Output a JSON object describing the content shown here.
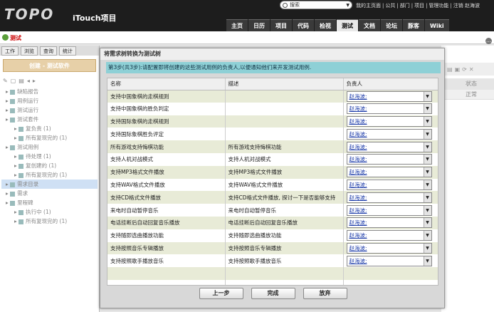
{
  "header": {
    "logo": "TOPO",
    "app_name": "iTouch项目",
    "search_placeholder": "搜索",
    "top_links": [
      "我的主页面",
      "公共",
      "部门",
      "项目",
      "管理功能",
      "注销 赵海波"
    ],
    "nav_tabs": [
      "主页",
      "日历",
      "项目",
      "代码",
      "检视",
      "测试",
      "文档",
      "论坛",
      "豚客",
      "Wiki"
    ],
    "active_tab": "测试"
  },
  "subbar": {
    "title": "测试"
  },
  "left": {
    "tabs": [
      "工作",
      "浏览",
      "查询",
      "统计"
    ],
    "create_button": "创建 - 测试软件",
    "tree": [
      {
        "label": "缺陷报告",
        "level": 0
      },
      {
        "label": "用例运行",
        "level": 0
      },
      {
        "label": "测试运行",
        "level": 0
      },
      {
        "label": "测试套件",
        "level": 0
      },
      {
        "label": "复负责 (1)",
        "level": 1
      },
      {
        "label": "所有复现完的 (1)",
        "level": 1
      },
      {
        "label": "测试用例",
        "level": 0
      },
      {
        "label": "待处理 (1)",
        "level": 1
      },
      {
        "label": "复创建的 (1)",
        "level": 1
      },
      {
        "label": "所有复现完的 (1)",
        "level": 1
      },
      {
        "label": "需求目录",
        "level": 0,
        "selected": true
      },
      {
        "label": "需求",
        "level": 0
      },
      {
        "label": "里程碑",
        "level": 0
      },
      {
        "label": "执行中 (1)",
        "level": 1
      },
      {
        "label": "所有复现完的 (1)",
        "level": 1
      }
    ]
  },
  "right": {
    "header": "状态",
    "row_value": "正常"
  },
  "dialog": {
    "title": "将需求树转换为测试树",
    "step_text": "第3步(共3步):请配置即将创建的这些测试用例的负责人,以便通知他们来开发测试用例.",
    "columns": [
      "名称",
      "描述",
      "负责人"
    ],
    "rows": [
      {
        "name": "支持中国象棋的走棋规则",
        "desc": "",
        "owner": "赵海波;"
      },
      {
        "name": "支持中国象棋的胜负判定",
        "desc": "",
        "owner": "赵海波;"
      },
      {
        "name": "支持国际象棋的走棋规则",
        "desc": "",
        "owner": "赵海波;"
      },
      {
        "name": "支持国际象棋胜负评定",
        "desc": "",
        "owner": "赵海波;"
      },
      {
        "name": "所有游戏支持悔棋功能",
        "desc": "所有游戏支持悔棋功能",
        "owner": "赵海波;"
      },
      {
        "name": "支持人机对战模式",
        "desc": "支持人机对战模式",
        "owner": "赵海波;"
      },
      {
        "name": "支持MP3格式文件播放",
        "desc": "支持MP3格式文件播放",
        "owner": "赵海波;"
      },
      {
        "name": "支持WAV格式文件播放",
        "desc": "支持WAV格式文件播放",
        "owner": "赵海波;"
      },
      {
        "name": "支持CD格式文件播放",
        "desc": "支持CD格式文件播放, 探讨一下是否能够支持",
        "owner": "赵海波;"
      },
      {
        "name": "来电时自动暂停音乐",
        "desc": "来电时自动暂停音乐",
        "owner": "赵海波;"
      },
      {
        "name": "电话挂断后自动回复音乐播放",
        "desc": "电话挂断后自动回复音乐播放",
        "owner": "赵海波;"
      },
      {
        "name": "支持随即选曲播放功能",
        "desc": "支持随即选曲播放功能",
        "owner": "赵海波;"
      },
      {
        "name": "支持按照音乐专辑播放",
        "desc": "支持按照音乐专辑播放",
        "owner": "赵海波;"
      },
      {
        "name": "支持按照歌手播放音乐",
        "desc": "支持按照歌手播放音乐",
        "owner": "赵海波;"
      }
    ],
    "buttons": {
      "prev": "上一步",
      "finish": "完成",
      "cancel": "放弃"
    }
  }
}
